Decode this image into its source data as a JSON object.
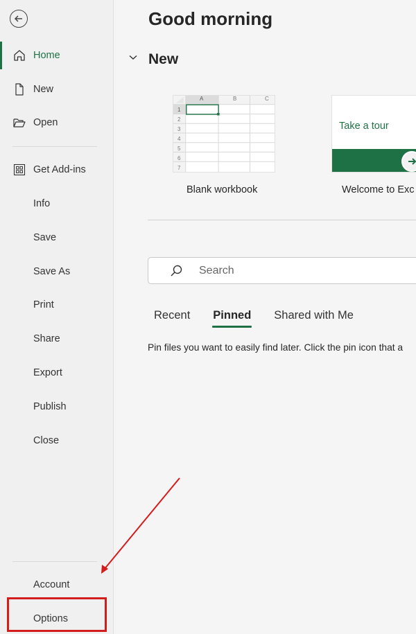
{
  "sidebar": {
    "back_icon": "arrow-left-circle-icon",
    "items": [
      {
        "label": "Home",
        "icon": "home-icon",
        "active": true
      },
      {
        "label": "New",
        "icon": "new-document-icon"
      },
      {
        "label": "Open",
        "icon": "folder-open-icon"
      },
      {
        "label": "Get Add-ins",
        "icon": "add-ins-grid-icon"
      },
      {
        "label": "Info"
      },
      {
        "label": "Save"
      },
      {
        "label": "Save As"
      },
      {
        "label": "Print"
      },
      {
        "label": "Share"
      },
      {
        "label": "Export"
      },
      {
        "label": "Publish"
      },
      {
        "label": "Close"
      }
    ],
    "bottom_items": [
      {
        "label": "Account"
      },
      {
        "label": "Options",
        "highlighted": true
      }
    ]
  },
  "main": {
    "greeting": "Good morning",
    "new_section": {
      "title": "New",
      "templates": [
        {
          "label": "Blank workbook",
          "columns": [
            "A",
            "B",
            "C"
          ],
          "rows": [
            "1",
            "2",
            "3",
            "4",
            "5",
            "6",
            "7"
          ]
        },
        {
          "label": "Welcome to Exc",
          "thumb_text": "Take a tour"
        }
      ]
    },
    "search": {
      "placeholder": "Search",
      "value": ""
    },
    "tabs": [
      {
        "label": "Recent"
      },
      {
        "label": "Pinned",
        "active": true
      },
      {
        "label": "Shared with Me"
      }
    ],
    "pinned_message": "Pin files you want to easily find later. Click the pin icon that a"
  },
  "colors": {
    "accent": "#1e7145",
    "sidebar_bg": "#f0f0f0",
    "main_bg": "#f5f5f5",
    "annotation": "#d31c1c"
  }
}
